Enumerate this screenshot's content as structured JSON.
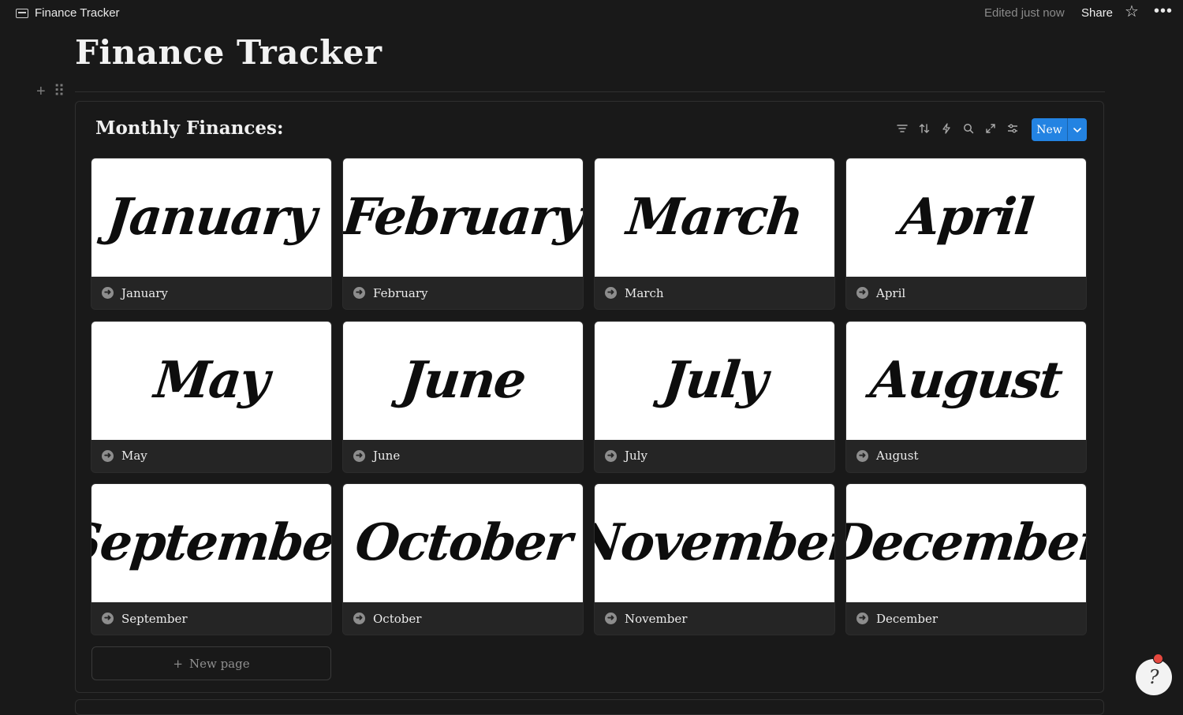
{
  "topbar": {
    "breadcrumb": "Finance Tracker",
    "edited": "Edited just now",
    "share_label": "Share",
    "star_icon": "star-icon",
    "more_icon": "more-icon"
  },
  "page": {
    "title": "Finance Tracker"
  },
  "database": {
    "title": "Monthly Finances:",
    "toolbar_icons": [
      "filter-icon",
      "sort-icon",
      "automation-icon",
      "search-icon",
      "expand-icon",
      "settings-icon"
    ],
    "new_label": "New",
    "new_page_label": "New page",
    "accent_color": "#2383e2",
    "cards": [
      {
        "cover_text": "January",
        "label": "January"
      },
      {
        "cover_text": "February",
        "label": "February"
      },
      {
        "cover_text": "March",
        "label": "March"
      },
      {
        "cover_text": "April",
        "label": "April"
      },
      {
        "cover_text": "May",
        "label": "May"
      },
      {
        "cover_text": "June",
        "label": "June"
      },
      {
        "cover_text": "July",
        "label": "July"
      },
      {
        "cover_text": "August",
        "label": "August"
      },
      {
        "cover_text": "September",
        "label": "September"
      },
      {
        "cover_text": "October",
        "label": "October"
      },
      {
        "cover_text": "November",
        "label": "November"
      },
      {
        "cover_text": "December",
        "label": "December"
      }
    ]
  }
}
